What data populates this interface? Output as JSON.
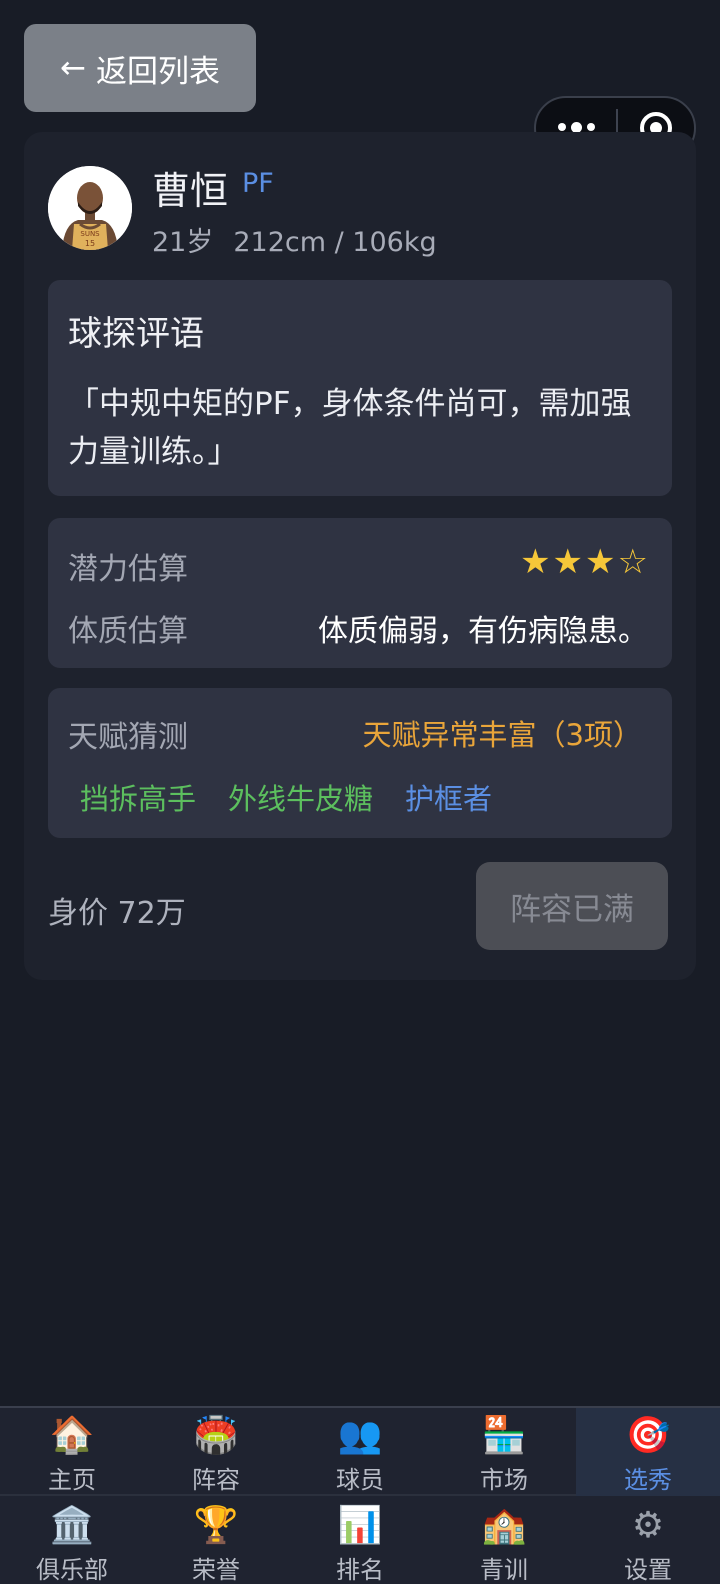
{
  "back_button": {
    "arrow": "←",
    "label": "返回列表"
  },
  "capsule": {
    "more_icon": "more-dots-icon",
    "close_icon": "target-icon"
  },
  "player": {
    "name": "曹恒",
    "position": "PF",
    "age": "21岁",
    "size": "212cm / 106kg",
    "avatar_jersey": "SUNS",
    "avatar_number": "15"
  },
  "scout": {
    "title": "球探评语",
    "comment": "「中规中矩的PF，身体条件尚可，需加强力量训练。」"
  },
  "estimates": {
    "potential_label": "潜力估算",
    "potential_stars_filled": "★★★",
    "potential_stars_empty": "☆",
    "potential_rating": {
      "filled": 3,
      "total": 4
    },
    "physique_label": "体质估算",
    "physique_value": "体质偏弱，有伤病隐患。"
  },
  "talent": {
    "label": "天赋猜测",
    "summary": "天赋异常丰富（3项）",
    "tags": [
      "挡拆高手",
      "外线牛皮糖",
      "护框者"
    ]
  },
  "price": "身价 72万",
  "action_button": "阵容已满",
  "tabbar": {
    "row1": [
      {
        "icon": "🏠",
        "label": "主页"
      },
      {
        "icon": "🏟️",
        "label": "阵容"
      },
      {
        "icon": "👥",
        "label": "球员"
      },
      {
        "icon": "🏪",
        "label": "市场"
      },
      {
        "icon": "🎯",
        "label": "选秀"
      }
    ],
    "row2": [
      {
        "icon": "🏛️",
        "label": "俱乐部"
      },
      {
        "icon": "🏆",
        "label": "荣誉"
      },
      {
        "icon": "📊",
        "label": "排名"
      },
      {
        "icon": "🏫",
        "label": "青训"
      },
      {
        "icon": "⚙",
        "label": "设置"
      }
    ],
    "active": "选秀"
  },
  "colors": {
    "background": "#181c26",
    "card": "#1e222d",
    "panel": "#2f3342",
    "accent_blue": "#5b8fe3",
    "star": "#f6c739",
    "talent_orange": "#e9a53a",
    "tag_green": "#5cbf5e"
  }
}
